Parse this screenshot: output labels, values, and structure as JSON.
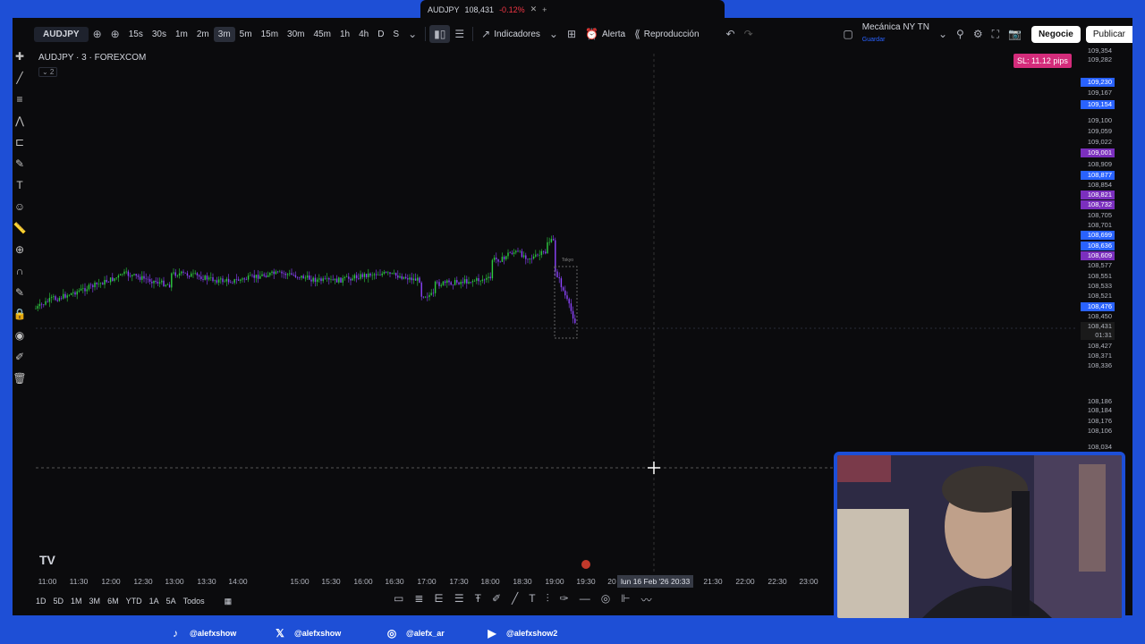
{
  "tab": {
    "symbol": "AUDJPY",
    "price": "108,431",
    "change": "-0.12%",
    "close": "✕",
    "add": "+"
  },
  "toolbar": {
    "symbol": "AUDJPY",
    "intervals": [
      "15s",
      "30s",
      "1m",
      "2m",
      "3m",
      "5m",
      "15m",
      "30m",
      "45m",
      "1h",
      "4h",
      "D",
      "S"
    ],
    "active_interval": "3m",
    "indicators_label": "Indicadores",
    "alert_label": "Alerta",
    "replay_label": "Reproducción",
    "layout_name": "Mecánica NY TN",
    "layout_sub": "Guardar",
    "negocie_label": "Negocie",
    "publicar_label": "Publicar"
  },
  "chart": {
    "title": "AUDJPY · 3 · FOREXCOM",
    "sub": "⌄ 2",
    "sl_badge": "SL: 11.12 pips",
    "candle_note": "Tokyo"
  },
  "price_axis": [
    {
      "v": "109,354",
      "c": ""
    },
    {
      "v": "109,282",
      "c": ""
    },
    {
      "v": "109,230",
      "c": "#2962ff"
    },
    {
      "v": "109,167",
      "c": ""
    },
    {
      "v": "109,154",
      "c": "#2962ff"
    },
    {
      "v": "109,100",
      "c": ""
    },
    {
      "v": "109,059",
      "c": ""
    },
    {
      "v": "109,022",
      "c": ""
    },
    {
      "v": "109,001",
      "c": "#7b2fbe"
    },
    {
      "v": "108,909",
      "c": ""
    },
    {
      "v": "108,877",
      "c": "#2962ff"
    },
    {
      "v": "108,854",
      "c": ""
    },
    {
      "v": "108,821",
      "c": "#7b2fbe"
    },
    {
      "v": "108,732",
      "c": "#7b2fbe"
    },
    {
      "v": "108,705",
      "c": ""
    },
    {
      "v": "108,701",
      "c": ""
    },
    {
      "v": "108,699",
      "c": "#2962ff"
    },
    {
      "v": "108,636",
      "c": "#2962ff"
    },
    {
      "v": "108,609",
      "c": "#7b2fbe"
    },
    {
      "v": "108,577",
      "c": ""
    },
    {
      "v": "108,551",
      "c": ""
    },
    {
      "v": "108,533",
      "c": ""
    },
    {
      "v": "108,521",
      "c": ""
    },
    {
      "v": "108,476",
      "c": "#2962ff"
    },
    {
      "v": "108,450",
      "c": ""
    },
    {
      "v": "108,431",
      "c": ""
    },
    {
      "v": "01:31",
      "c": ""
    },
    {
      "v": "108,427",
      "c": ""
    },
    {
      "v": "108,371",
      "c": ""
    },
    {
      "v": "108,336",
      "c": ""
    },
    {
      "v": "108,186",
      "c": ""
    },
    {
      "v": "108,184",
      "c": ""
    },
    {
      "v": "108,176",
      "c": ""
    },
    {
      "v": "108,106",
      "c": ""
    },
    {
      "v": "108,034",
      "c": ""
    }
  ],
  "time_axis": [
    "11:00",
    "11:30",
    "12:00",
    "12:30",
    "13:00",
    "13:30",
    "14:00",
    "15:00",
    "15:30",
    "16:00",
    "16:30",
    "17:00",
    "17:30",
    "18:00",
    "18:30",
    "19:00",
    "19:30",
    "20",
    "21:30",
    "22:00",
    "22:30",
    "23:00"
  ],
  "crosshair_date": "lun 16 Feb '26   20:33",
  "bottom_ranges": [
    "1D",
    "5D",
    "1M",
    "3M",
    "6M",
    "YTD",
    "1A",
    "5A",
    "Todos"
  ],
  "tv_logo": "TV",
  "social": [
    {
      "handle": "@alefxshow",
      "icon": "tiktok-icon",
      "color": "#ffffff"
    },
    {
      "handle": "@alefxshow",
      "icon": "x-icon",
      "color": "#ffffff"
    },
    {
      "handle": "@alefx_ar",
      "icon": "instagram-icon",
      "color": "#ffffff"
    },
    {
      "handle": "@alefxshow2",
      "icon": "youtube-icon",
      "color": "#ffffff"
    }
  ],
  "colors": {
    "bull": "#2ecc40",
    "bear": "#8e44ff",
    "accent": "#1e4fd6",
    "sl": "#d42c7b"
  }
}
